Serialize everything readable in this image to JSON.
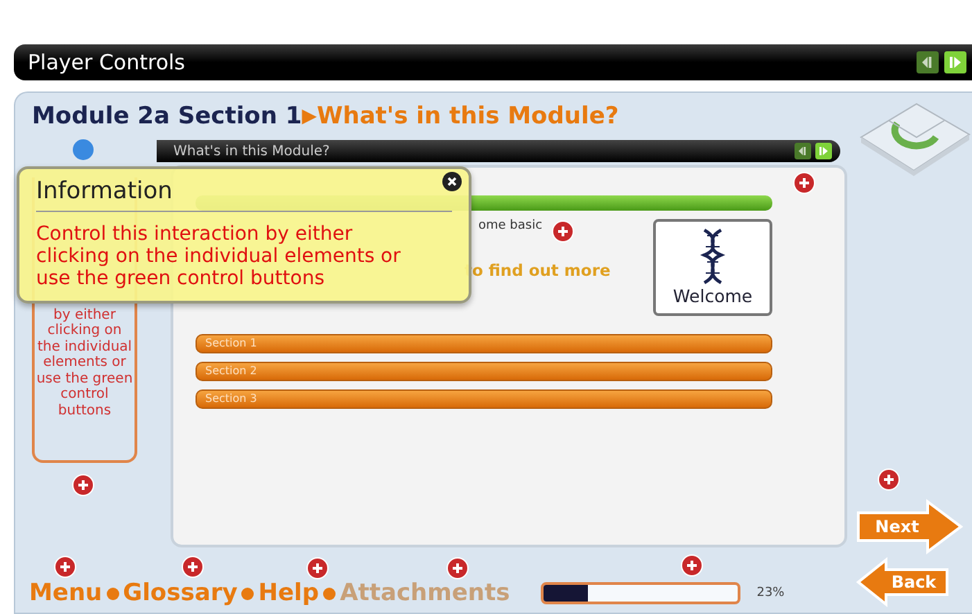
{
  "player_bar": {
    "title": "Player Controls",
    "buttons": [
      {
        "kind": "previous",
        "disabled": true
      },
      {
        "kind": "next",
        "disabled": false
      }
    ]
  },
  "module": {
    "title": "Module 2a Section 1",
    "separator": "▶",
    "subtitle": "What's in this Module?"
  },
  "help_box": {
    "text": "by either clicking on the individual elements or use the green control buttons"
  },
  "content": {
    "bar_title": "What's in this Module?",
    "bar_buttons": [
      {
        "kind": "previous",
        "disabled": true
      },
      {
        "kind": "next",
        "disabled": false
      }
    ],
    "intro": "ome basic",
    "prompt": "to find out more",
    "card_label": "Welcome",
    "sections": [
      {
        "label": "Section 1"
      },
      {
        "label": "Section 2"
      },
      {
        "label": "Section 3"
      }
    ]
  },
  "popup": {
    "title": "Information",
    "text": "Control this interaction by either clicking on the individual elements or use the green control buttons"
  },
  "nav": [
    {
      "label": "Menu",
      "disabled": false
    },
    {
      "label": "Glossary",
      "disabled": false
    },
    {
      "label": "Help",
      "disabled": false
    },
    {
      "label": "Attachments",
      "disabled": true
    }
  ],
  "progress": {
    "level": 0.23,
    "reading": "23%"
  },
  "arrows": [
    {
      "kind": "next",
      "label": "Next"
    },
    {
      "kind": "back",
      "label": "Back"
    }
  ]
}
